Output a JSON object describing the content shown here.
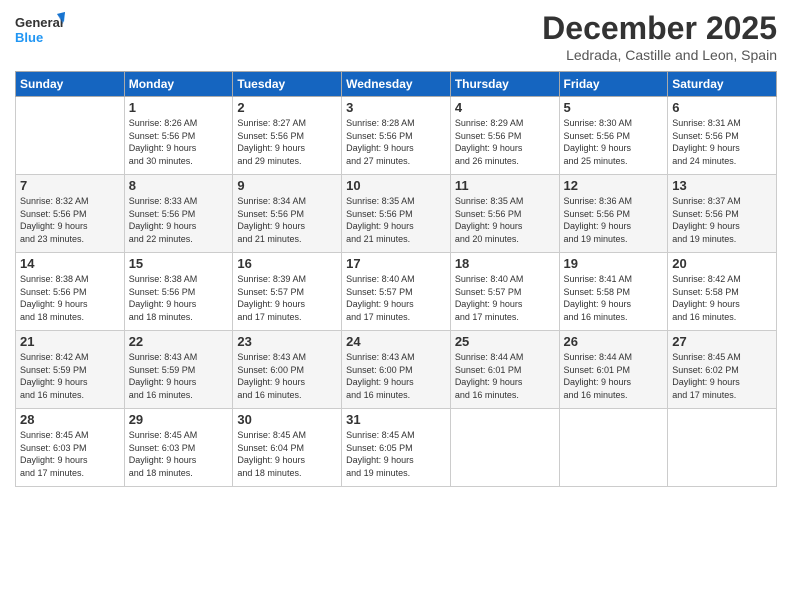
{
  "logo": {
    "line1": "General",
    "line2": "Blue"
  },
  "title": "December 2025",
  "location": "Ledrada, Castille and Leon, Spain",
  "days_header": [
    "Sunday",
    "Monday",
    "Tuesday",
    "Wednesday",
    "Thursday",
    "Friday",
    "Saturday"
  ],
  "weeks": [
    [
      {
        "day": "",
        "info": ""
      },
      {
        "day": "1",
        "info": "Sunrise: 8:26 AM\nSunset: 5:56 PM\nDaylight: 9 hours\nand 30 minutes."
      },
      {
        "day": "2",
        "info": "Sunrise: 8:27 AM\nSunset: 5:56 PM\nDaylight: 9 hours\nand 29 minutes."
      },
      {
        "day": "3",
        "info": "Sunrise: 8:28 AM\nSunset: 5:56 PM\nDaylight: 9 hours\nand 27 minutes."
      },
      {
        "day": "4",
        "info": "Sunrise: 8:29 AM\nSunset: 5:56 PM\nDaylight: 9 hours\nand 26 minutes."
      },
      {
        "day": "5",
        "info": "Sunrise: 8:30 AM\nSunset: 5:56 PM\nDaylight: 9 hours\nand 25 minutes."
      },
      {
        "day": "6",
        "info": "Sunrise: 8:31 AM\nSunset: 5:56 PM\nDaylight: 9 hours\nand 24 minutes."
      }
    ],
    [
      {
        "day": "7",
        "info": "Sunrise: 8:32 AM\nSunset: 5:56 PM\nDaylight: 9 hours\nand 23 minutes."
      },
      {
        "day": "8",
        "info": "Sunrise: 8:33 AM\nSunset: 5:56 PM\nDaylight: 9 hours\nand 22 minutes."
      },
      {
        "day": "9",
        "info": "Sunrise: 8:34 AM\nSunset: 5:56 PM\nDaylight: 9 hours\nand 21 minutes."
      },
      {
        "day": "10",
        "info": "Sunrise: 8:35 AM\nSunset: 5:56 PM\nDaylight: 9 hours\nand 21 minutes."
      },
      {
        "day": "11",
        "info": "Sunrise: 8:35 AM\nSunset: 5:56 PM\nDaylight: 9 hours\nand 20 minutes."
      },
      {
        "day": "12",
        "info": "Sunrise: 8:36 AM\nSunset: 5:56 PM\nDaylight: 9 hours\nand 19 minutes."
      },
      {
        "day": "13",
        "info": "Sunrise: 8:37 AM\nSunset: 5:56 PM\nDaylight: 9 hours\nand 19 minutes."
      }
    ],
    [
      {
        "day": "14",
        "info": "Sunrise: 8:38 AM\nSunset: 5:56 PM\nDaylight: 9 hours\nand 18 minutes."
      },
      {
        "day": "15",
        "info": "Sunrise: 8:38 AM\nSunset: 5:56 PM\nDaylight: 9 hours\nand 18 minutes."
      },
      {
        "day": "16",
        "info": "Sunrise: 8:39 AM\nSunset: 5:57 PM\nDaylight: 9 hours\nand 17 minutes."
      },
      {
        "day": "17",
        "info": "Sunrise: 8:40 AM\nSunset: 5:57 PM\nDaylight: 9 hours\nand 17 minutes."
      },
      {
        "day": "18",
        "info": "Sunrise: 8:40 AM\nSunset: 5:57 PM\nDaylight: 9 hours\nand 17 minutes."
      },
      {
        "day": "19",
        "info": "Sunrise: 8:41 AM\nSunset: 5:58 PM\nDaylight: 9 hours\nand 16 minutes."
      },
      {
        "day": "20",
        "info": "Sunrise: 8:42 AM\nSunset: 5:58 PM\nDaylight: 9 hours\nand 16 minutes."
      }
    ],
    [
      {
        "day": "21",
        "info": "Sunrise: 8:42 AM\nSunset: 5:59 PM\nDaylight: 9 hours\nand 16 minutes."
      },
      {
        "day": "22",
        "info": "Sunrise: 8:43 AM\nSunset: 5:59 PM\nDaylight: 9 hours\nand 16 minutes."
      },
      {
        "day": "23",
        "info": "Sunrise: 8:43 AM\nSunset: 6:00 PM\nDaylight: 9 hours\nand 16 minutes."
      },
      {
        "day": "24",
        "info": "Sunrise: 8:43 AM\nSunset: 6:00 PM\nDaylight: 9 hours\nand 16 minutes."
      },
      {
        "day": "25",
        "info": "Sunrise: 8:44 AM\nSunset: 6:01 PM\nDaylight: 9 hours\nand 16 minutes."
      },
      {
        "day": "26",
        "info": "Sunrise: 8:44 AM\nSunset: 6:01 PM\nDaylight: 9 hours\nand 16 minutes."
      },
      {
        "day": "27",
        "info": "Sunrise: 8:45 AM\nSunset: 6:02 PM\nDaylight: 9 hours\nand 17 minutes."
      }
    ],
    [
      {
        "day": "28",
        "info": "Sunrise: 8:45 AM\nSunset: 6:03 PM\nDaylight: 9 hours\nand 17 minutes."
      },
      {
        "day": "29",
        "info": "Sunrise: 8:45 AM\nSunset: 6:03 PM\nDaylight: 9 hours\nand 18 minutes."
      },
      {
        "day": "30",
        "info": "Sunrise: 8:45 AM\nSunset: 6:04 PM\nDaylight: 9 hours\nand 18 minutes."
      },
      {
        "day": "31",
        "info": "Sunrise: 8:45 AM\nSunset: 6:05 PM\nDaylight: 9 hours\nand 19 minutes."
      },
      {
        "day": "",
        "info": ""
      },
      {
        "day": "",
        "info": ""
      },
      {
        "day": "",
        "info": ""
      }
    ]
  ]
}
